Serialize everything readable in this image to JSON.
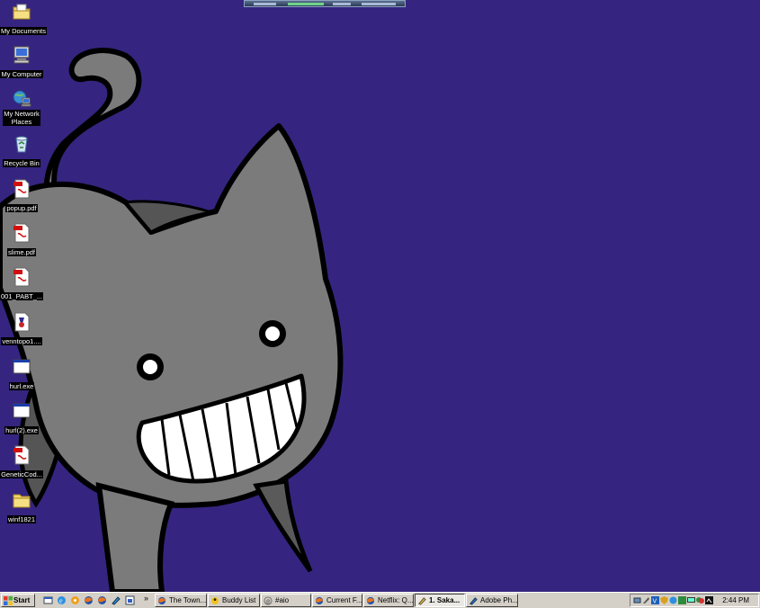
{
  "desktop": {
    "background_color": "#352580",
    "icons": [
      {
        "label": "My Documents",
        "icon": "my-documents-folder-icon"
      },
      {
        "label": "My Computer",
        "icon": "my-computer-icon"
      },
      {
        "label": "My Network Places",
        "icon": "network-places-icon"
      },
      {
        "label": "Recycle Bin",
        "icon": "recycle-bin-icon"
      },
      {
        "label": "popup.pdf",
        "icon": "pdf-file-icon"
      },
      {
        "label": "slime.pdf",
        "icon": "pdf-file-icon"
      },
      {
        "label": "001_PABT_...",
        "icon": "pdf-file-icon"
      },
      {
        "label": "venntopo1....",
        "icon": "app-file-icon"
      },
      {
        "label": "hurl.exe",
        "icon": "exe-window-icon"
      },
      {
        "label": "hurl(2).exe",
        "icon": "exe-window-icon"
      },
      {
        "label": "GeneticCod...",
        "icon": "pdf-file-icon"
      },
      {
        "label": "winf1821",
        "icon": "folder-icon"
      }
    ]
  },
  "taskbar": {
    "start_label": "Start",
    "overflow_label": "»",
    "quick_launch": [
      "show-desktop-icon",
      "ie-icon",
      "media-icon",
      "firefox-icon",
      "firefox-icon",
      "edit-icon",
      "window-icon"
    ],
    "tasks": [
      {
        "label": "The Town...",
        "icon": "firefox-icon",
        "active": false
      },
      {
        "label": "Buddy List",
        "icon": "aim-icon",
        "active": false
      },
      {
        "label": "#aio",
        "icon": "chat-icon",
        "active": false
      },
      {
        "label": "Current F...",
        "icon": "firefox-icon",
        "active": false
      },
      {
        "label": "Netflix: Q...",
        "icon": "firefox-icon",
        "active": false
      },
      {
        "label": "1. Saka...",
        "icon": "pencil-icon",
        "active": true
      },
      {
        "label": "Adobe Ph...",
        "icon": "photoshop-icon",
        "active": false
      }
    ],
    "clock": "2:44 PM"
  }
}
